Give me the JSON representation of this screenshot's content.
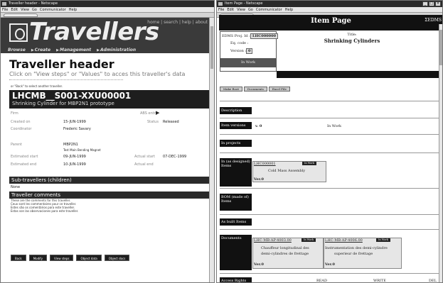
{
  "left": {
    "window_title": "Traveller header - Netscape",
    "menu": [
      "File",
      "Edit",
      "View",
      "Go",
      "Communicator",
      "Help"
    ],
    "toplinks": "home | search | help | about",
    "logo_text": "Travellers",
    "nav": [
      "Browse",
      "Create",
      "Management",
      "Administration"
    ],
    "page_title": "Traveller header",
    "subtitle": "Click on \"View steps\" or \"Values\" to acces this traveller's data",
    "back_note": "or \"Back\" to select another traveller.",
    "code": "LHCMB__S001-XXU00001",
    "description": "Shrinking Cylinder for MBP2N1 prototype",
    "fields": {
      "firm_label": "Firm",
      "abs_entry_label": "ABS entry",
      "created_on_label": "Created on",
      "created_on": "15-JUN-1999",
      "status_label": "Status",
      "status": "Released",
      "coordinator_label": "Coordinator",
      "coordinator": "Frederic Savary",
      "parent_label": "Parent",
      "parent": "MBP2N1",
      "parent_desc": "Test Main Bending Magnet",
      "est_start_label": "Estimated start",
      "est_start": "09-JUN-1999",
      "actual_start_label": "Actual start",
      "actual_start": "07-DEC-1999",
      "est_end_label": "Estimated end",
      "est_end": "10-JUN-1999",
      "actual_end_label": "Actual end"
    },
    "subtravellers_title": "Sub-travellers (children)",
    "subtravellers_value": "None",
    "comments_title": "Traveller comments",
    "comments": [
      "These are the comments for this traveller.",
      "Ceux sont les commentaires pour ce traveller.",
      "Estes são os comentários para este traveller.",
      "Estas son las observaciones para este traveller."
    ],
    "buttons": [
      "Back",
      "Modify",
      "View steps",
      "Object data",
      "Object docs"
    ]
  },
  "right": {
    "window_title": "Item Page - Netscape",
    "menu": [
      "File",
      "Edit",
      "View",
      "Go",
      "Communicator",
      "Help"
    ],
    "page_title": "Item Page",
    "edms_logo": "EDMS",
    "info": {
      "proj_id_label": "EDMS Proj. Id :",
      "proj_id": "LHC000000",
      "eq_code_label": "Eq. code :",
      "version_label": "Version :",
      "version": "0",
      "state": "In Work"
    },
    "title_label": "Title:",
    "title_value": "Shrinking Cylinders",
    "buttons": [
      "Make Root",
      "Documents",
      "Excel File"
    ],
    "description_label": "Description",
    "versions_label": "Item versions",
    "version_value": "v. 0",
    "version_state": "In Work",
    "projects_label": "In projects",
    "designed_label": "In (as designed) Items",
    "designed_item": {
      "code": "LHC000001",
      "state": "In Work",
      "title": "Cold Mass Assembly",
      "ver": "Ver.0"
    },
    "bom_label": "BOM (made of) Items",
    "asbuilt_label": "As built Items",
    "documents_label": "Documents",
    "documents": [
      {
        "code": "LHC-MB-AP-4003.00",
        "state": "In Work",
        "title1": "Chauffeur longitudinal des",
        "title2": "demi-cylindres de frettage",
        "ver": "Ver.0"
      },
      {
        "code": "LHC-MB-AP-4006.00",
        "state": "In Work",
        "title1": "Instrumentation des demi-cylindre",
        "title2": "superieur de frettage",
        "ver": "Ver.0"
      }
    ],
    "access_rights_label": "Access Rights",
    "access_cols": [
      "READ",
      "WRITE",
      "DEL"
    ]
  }
}
